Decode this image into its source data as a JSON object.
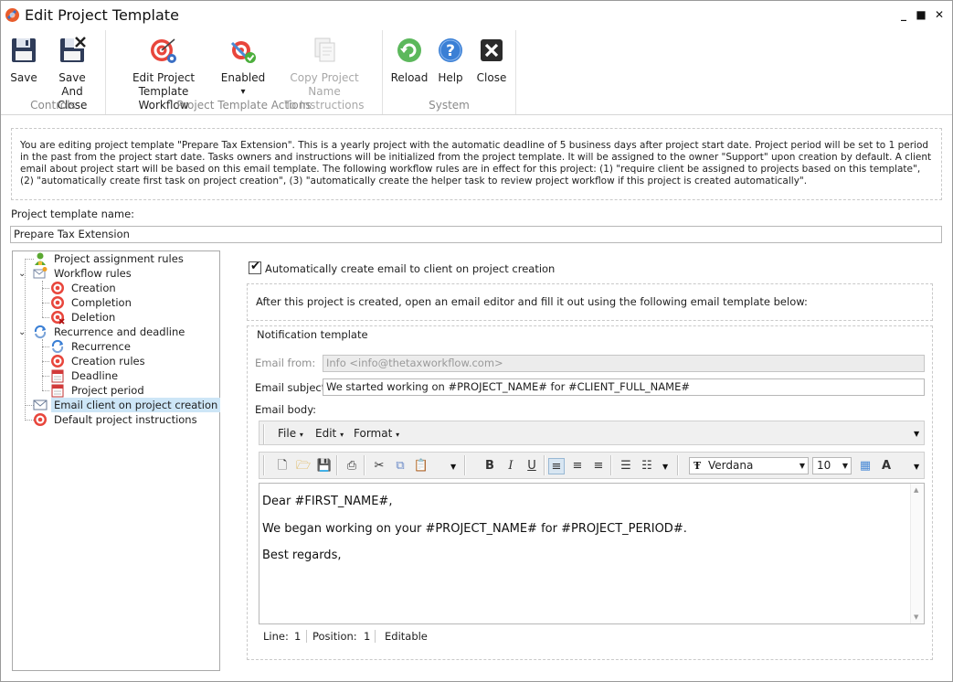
{
  "window": {
    "title": "Edit Project Template",
    "controls": {
      "minimize": "▁",
      "maximize": "□",
      "close": "✕"
    }
  },
  "ribbon": {
    "groups": [
      {
        "caption": "Controls",
        "buttons": [
          {
            "label1": "Save",
            "label2": "",
            "icon": "floppy-disk-icon"
          },
          {
            "label1": "Save And",
            "label2": "Close",
            "icon": "floppy-close-icon"
          }
        ]
      },
      {
        "caption": "Project Template Actions",
        "buttons": [
          {
            "label1": "Edit Project",
            "label2": "Template Workflow",
            "icon": "target-workflow-icon"
          },
          {
            "label1": "Enabled",
            "label2": "▾",
            "icon": "enabled-toggle-icon"
          },
          {
            "label1": "Copy Project Name",
            "label2": "To Instructions",
            "icon": "copy-document-icon",
            "disabled": true
          }
        ]
      },
      {
        "caption": "System",
        "buttons": [
          {
            "label1": "Reload",
            "label2": "",
            "icon": "reload-icon"
          },
          {
            "label1": "Help",
            "label2": "",
            "icon": "help-icon"
          },
          {
            "label1": "Close",
            "label2": "",
            "icon": "close-icon"
          }
        ]
      }
    ]
  },
  "description": "You are editing project template \"Prepare Tax Extension\". This is a yearly project with the automatic deadline of 5 business days after project start date. Project period will be set to 1 period in the past from the project start date. Tasks owners and instructions will be initialized from the project template. It will be assigned to the owner \"Support\" upon creation by default. A client email about project start will be based on this email template. The following workflow rules are in effect for this project: (1) \"require client be assigned to projects based on this template\", (2) \"automatically create first task on project creation\", (3) \"automatically create the helper task to review project workflow if this project is created automatically\".",
  "template_name": {
    "label": "Project template name:",
    "value": "Prepare Tax Extension"
  },
  "tree": {
    "items": [
      {
        "label": "Project assignment rules",
        "icon": "person-icon"
      },
      {
        "label": "Workflow rules",
        "icon": "workflow-email-icon"
      },
      {
        "label": "Creation",
        "icon": "target-icon"
      },
      {
        "label": "Completion",
        "icon": "target-icon"
      },
      {
        "label": "Deletion",
        "icon": "target-delete-icon"
      },
      {
        "label": "Recurrence and deadline",
        "icon": "recurrence-icon"
      },
      {
        "label": "Recurrence",
        "icon": "recurrence-icon"
      },
      {
        "label": "Creation rules",
        "icon": "target-icon"
      },
      {
        "label": "Deadline",
        "icon": "calendar-icon"
      },
      {
        "label": "Project period",
        "icon": "calendar-icon"
      },
      {
        "label": "Email client on project creation",
        "icon": "envelope-icon",
        "selected": true
      },
      {
        "label": "Default project instructions",
        "icon": "target-icon"
      }
    ]
  },
  "auto_email": {
    "label": "Automatically create email to client on project creation",
    "checked": true
  },
  "info_text": "After this project is created, open an email editor and fill it out using the following email template below:",
  "notification": {
    "title": "Notification template",
    "from_label": "Email from:",
    "from_value": "Info <info@thetaxworkflow.com>",
    "subject_label": "Email subject:",
    "subject_value": "We started working on #PROJECT_NAME# for #CLIENT_FULL_NAME#",
    "body_label": "Email body:",
    "menus": [
      "File",
      "Edit",
      "Format"
    ],
    "font_name": "Verdana",
    "font_size": "10",
    "body_lines": [
      "Dear #FIRST_NAME#,",
      "We began working on your #PROJECT_NAME# for #PROJECT_PERIOD#.",
      "Best regards,"
    ],
    "status": {
      "line_label": "Line:",
      "line_value": "1",
      "position_label": "Position:",
      "position_value": "1",
      "mode": "Editable"
    }
  }
}
